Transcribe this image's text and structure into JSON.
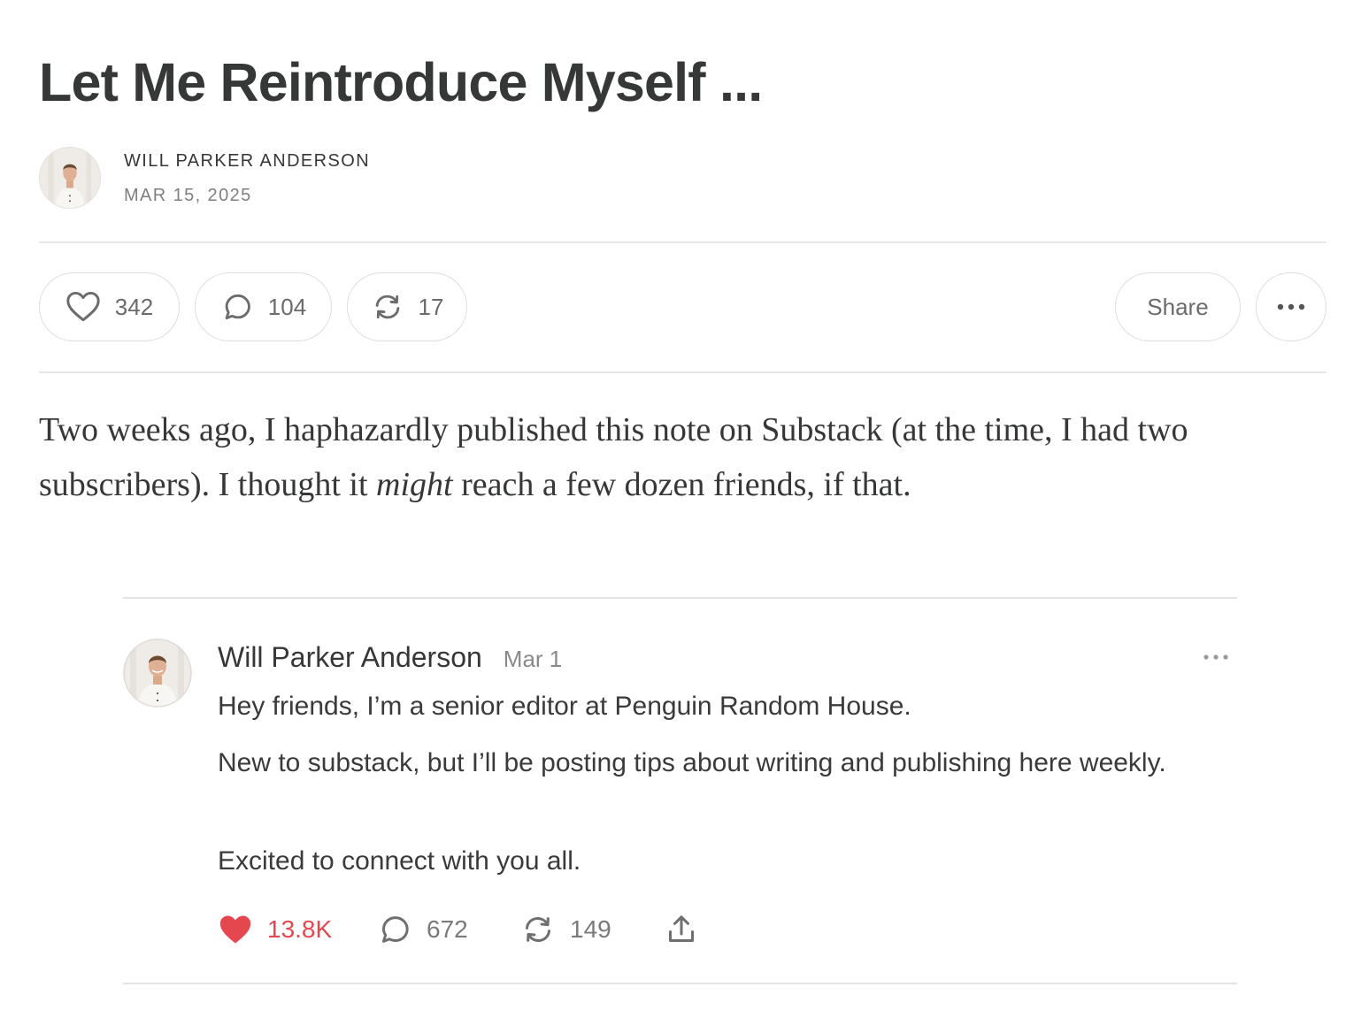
{
  "post": {
    "title": "Let Me Reintroduce Myself ...",
    "author": "WILL PARKER ANDERSON",
    "date": "MAR 15, 2025"
  },
  "actions": {
    "likes": "342",
    "comments": "104",
    "restacks": "17",
    "share_label": "Share"
  },
  "body": {
    "part1": "Two weeks ago, I haphazardly published this note on Substack (at the time, I had two subscribers). I thought it ",
    "emphasis": "might",
    "part2": " reach a few dozen friends, if that."
  },
  "note": {
    "author": "Will Parker Anderson",
    "date": "Mar 1",
    "lines": [
      "Hey friends, I’m a senior editor at Penguin Random House.",
      "New to substack, but I’ll be posting tips about writing and publishing here weekly.",
      "Excited to connect with you all."
    ],
    "likes": "13.8K",
    "comments": "672",
    "restacks": "149"
  },
  "colors": {
    "text": "#363737",
    "muted": "#7f7f7f",
    "like_red": "#e5474f",
    "border": "#dddddd"
  },
  "icons": {
    "like": "heart-icon",
    "comment": "comment-bubble-icon",
    "restack": "restack-icon",
    "more": "ellipsis-icon",
    "share": "upload-share-icon"
  }
}
